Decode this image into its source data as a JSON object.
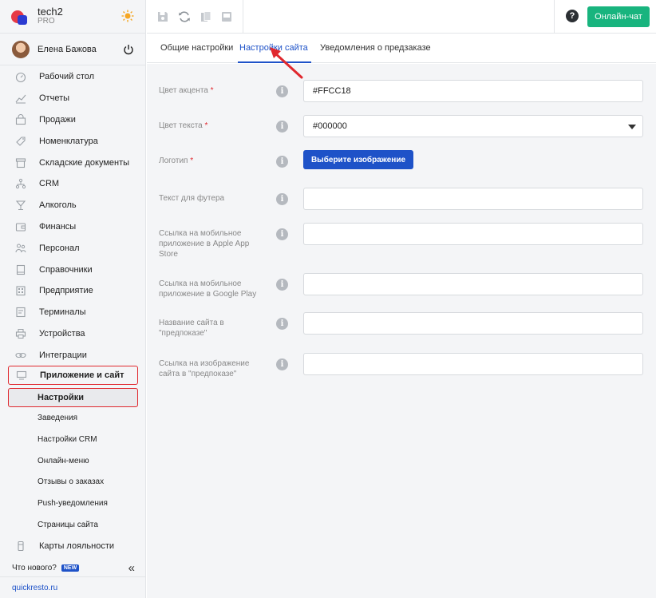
{
  "brand": {
    "name": "tech2",
    "plan": "PRO"
  },
  "user": {
    "name": "Елена Бажова"
  },
  "nav": {
    "items": [
      {
        "label": "Рабочий стол",
        "icon": "dashboard-icon"
      },
      {
        "label": "Отчеты",
        "icon": "reports-icon"
      },
      {
        "label": "Продажи",
        "icon": "sales-icon"
      },
      {
        "label": "Номенклатура",
        "icon": "nomenclature-icon"
      },
      {
        "label": "Складские документы",
        "icon": "warehouse-icon"
      },
      {
        "label": "CRM",
        "icon": "crm-icon"
      },
      {
        "label": "Алкоголь",
        "icon": "alcohol-icon"
      },
      {
        "label": "Финансы",
        "icon": "finance-icon"
      },
      {
        "label": "Персонал",
        "icon": "staff-icon"
      },
      {
        "label": "Справочники",
        "icon": "reference-icon"
      },
      {
        "label": "Предприятие",
        "icon": "enterprise-icon"
      },
      {
        "label": "Терминалы",
        "icon": "terminals-icon"
      },
      {
        "label": "Устройства",
        "icon": "devices-icon"
      },
      {
        "label": "Интеграции",
        "icon": "integrations-icon"
      }
    ],
    "active_parent": "Приложение и сайт",
    "sub_items": [
      {
        "label": "Настройки",
        "active": true
      },
      {
        "label": "Заведения"
      },
      {
        "label": "Настройки CRM"
      },
      {
        "label": "Онлайн-меню"
      },
      {
        "label": "Отзывы о заказах"
      },
      {
        "label": "Push-уведомления"
      },
      {
        "label": "Страницы сайта"
      }
    ],
    "loyalty": "Карты лояльности"
  },
  "whatsnew": {
    "label": "Что нового?",
    "badge": "NEW"
  },
  "footer": {
    "link": "quickresto.ru"
  },
  "topbar": {
    "chat_label": "Онлайн-чат",
    "help": "?"
  },
  "tabs": [
    {
      "label": "Общие настройки"
    },
    {
      "label": "Настройки сайта",
      "active": true
    },
    {
      "label": "Уведомления о предзаказе"
    }
  ],
  "form": {
    "accent_color": {
      "label": "Цвет акцента",
      "required": "*",
      "value": "#FFCC18"
    },
    "text_color": {
      "label": "Цвет текста",
      "required": "*",
      "value": "#000000"
    },
    "logo": {
      "label": "Логотип",
      "required": "*",
      "button": "Выберите изображение"
    },
    "footer_text": {
      "label": "Текст для футера",
      "value": ""
    },
    "apple_link": {
      "label": "Ссылка на мобильное приложение в Apple App Store",
      "value": ""
    },
    "google_link": {
      "label": "Ссылка на мобильное приложение в Google Play",
      "value": ""
    },
    "preorder_name": {
      "label": "Название сайта в \"предпоказе\"",
      "value": ""
    },
    "preorder_image": {
      "label": "Ссылка на изображение сайта в \"предпоказе\"",
      "value": ""
    }
  },
  "colors": {
    "accent": "#1e52c8",
    "chat": "#18b47e",
    "highlight": "#e0282e"
  }
}
